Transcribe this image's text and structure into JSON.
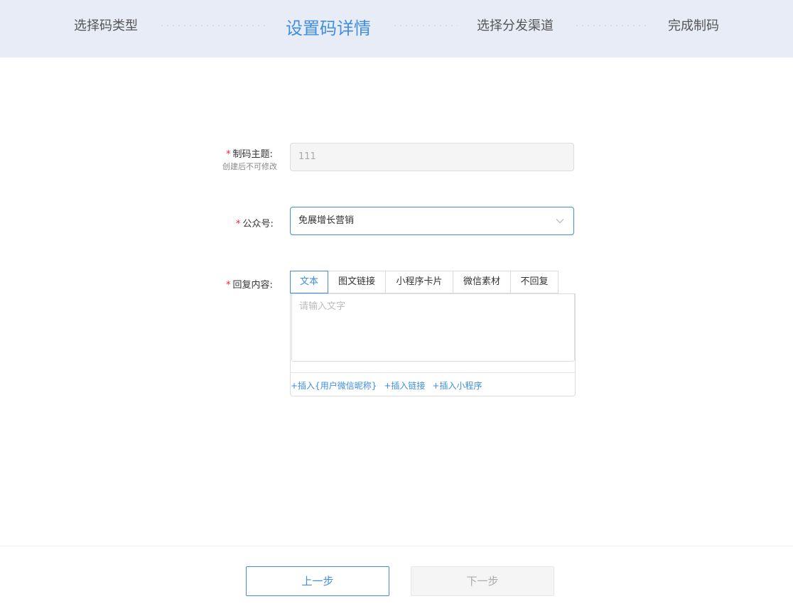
{
  "steps": {
    "items": [
      {
        "label": "选择码类型"
      },
      {
        "label": "设置码详情"
      },
      {
        "label": "选择分发渠道"
      },
      {
        "label": "完成制码"
      }
    ],
    "active_index": 1
  },
  "form": {
    "required_mark": "*",
    "topic": {
      "label": "制码主题:",
      "hint": "创建后不可修改",
      "value": "111"
    },
    "account": {
      "label": "公众号:",
      "value": "免展增长营销",
      "icon": "chevron-down-icon"
    },
    "reply": {
      "label": "回复内容:",
      "tabs": [
        {
          "label": "文本"
        },
        {
          "label": "图文链接"
        },
        {
          "label": "小程序卡片"
        },
        {
          "label": "微信素材"
        },
        {
          "label": "不回复"
        }
      ],
      "active_tab": 0,
      "placeholder": "请输入文字",
      "insert_links": [
        {
          "label": "+插入{用户微信昵称}"
        },
        {
          "label": "+插入链接"
        },
        {
          "label": "+插入小程序"
        }
      ]
    }
  },
  "footer": {
    "prev_label": "上一步",
    "next_label": "下一步"
  },
  "colors": {
    "accent": "#3f8ee0",
    "header_bg": "#e8ecf6",
    "required": "#f5222d"
  }
}
